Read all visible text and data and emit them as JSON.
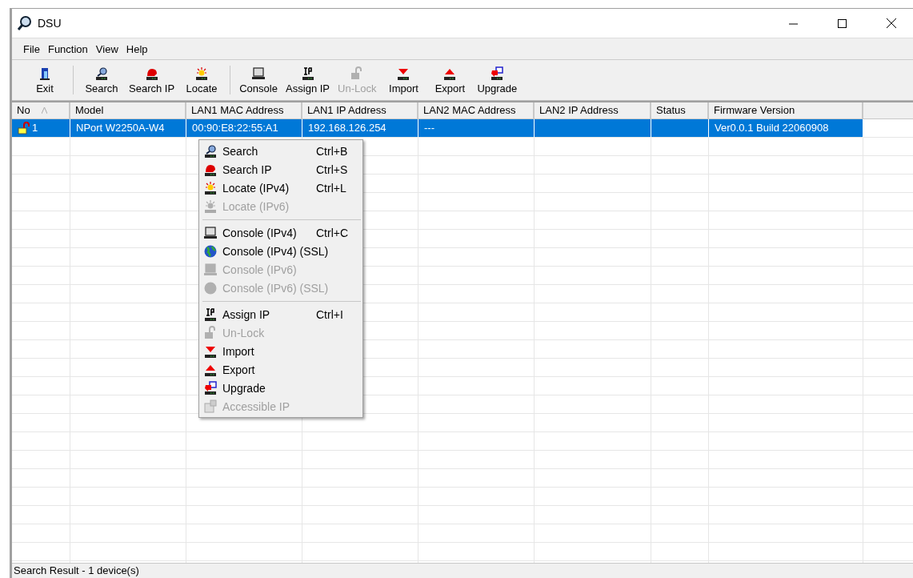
{
  "window": {
    "title": "DSU"
  },
  "menu_bar": [
    {
      "label": "File"
    },
    {
      "label": "Function"
    },
    {
      "label": "View"
    },
    {
      "label": "Help"
    }
  ],
  "toolbar": [
    {
      "label": "Exit",
      "disabled": false
    },
    {
      "label": "Search",
      "disabled": false
    },
    {
      "label": "Search IP",
      "disabled": false
    },
    {
      "label": "Locate",
      "disabled": false
    },
    {
      "label": "Console",
      "disabled": false
    },
    {
      "label": "Assign IP",
      "disabled": false
    },
    {
      "label": "Un-Lock",
      "disabled": true
    },
    {
      "label": "Import",
      "disabled": false
    },
    {
      "label": "Export",
      "disabled": false
    },
    {
      "label": "Upgrade",
      "disabled": false
    }
  ],
  "table": {
    "columns": [
      "No",
      "Model",
      "LAN1 MAC Address",
      "LAN1 IP Address",
      "LAN2 MAC Address",
      "LAN2 IP Address",
      "Status",
      "Firmware Version"
    ],
    "rows": [
      {
        "selected": true,
        "cells": [
          "1",
          "NPort W2250A-W4",
          "00:90:E8:22:55:A1",
          "192.168.126.254",
          "---",
          "",
          "",
          "Ver0.0.1 Build 22060908"
        ]
      }
    ]
  },
  "context_menu": [
    {
      "kind": "item",
      "label": "Search",
      "shortcut": "Ctrl+B",
      "disabled": false
    },
    {
      "kind": "item",
      "label": "Search IP",
      "shortcut": "Ctrl+S",
      "disabled": false
    },
    {
      "kind": "item",
      "label": "Locate (IPv4)",
      "shortcut": "Ctrl+L",
      "disabled": false
    },
    {
      "kind": "item",
      "label": "Locate (IPv6)",
      "disabled": true
    },
    {
      "kind": "separator"
    },
    {
      "kind": "item",
      "label": "Console (IPv4)",
      "shortcut": "Ctrl+C",
      "disabled": false
    },
    {
      "kind": "item",
      "label": "Console (IPv4) (SSL)",
      "disabled": false
    },
    {
      "kind": "item",
      "label": "Console (IPv6)",
      "disabled": true
    },
    {
      "kind": "item",
      "label": "Console (IPv6) (SSL)",
      "disabled": true
    },
    {
      "kind": "separator"
    },
    {
      "kind": "item",
      "label": "Assign IP",
      "shortcut": "Ctrl+I",
      "disabled": false
    },
    {
      "kind": "item",
      "label": "Un-Lock",
      "disabled": true
    },
    {
      "kind": "item",
      "label": "Import",
      "disabled": false
    },
    {
      "kind": "item",
      "label": "Export",
      "disabled": false
    },
    {
      "kind": "item",
      "label": "Upgrade",
      "disabled": false
    },
    {
      "kind": "item",
      "label": "Accessible IP",
      "disabled": true
    }
  ],
  "status_bar": "Search Result - 1 device(s)"
}
